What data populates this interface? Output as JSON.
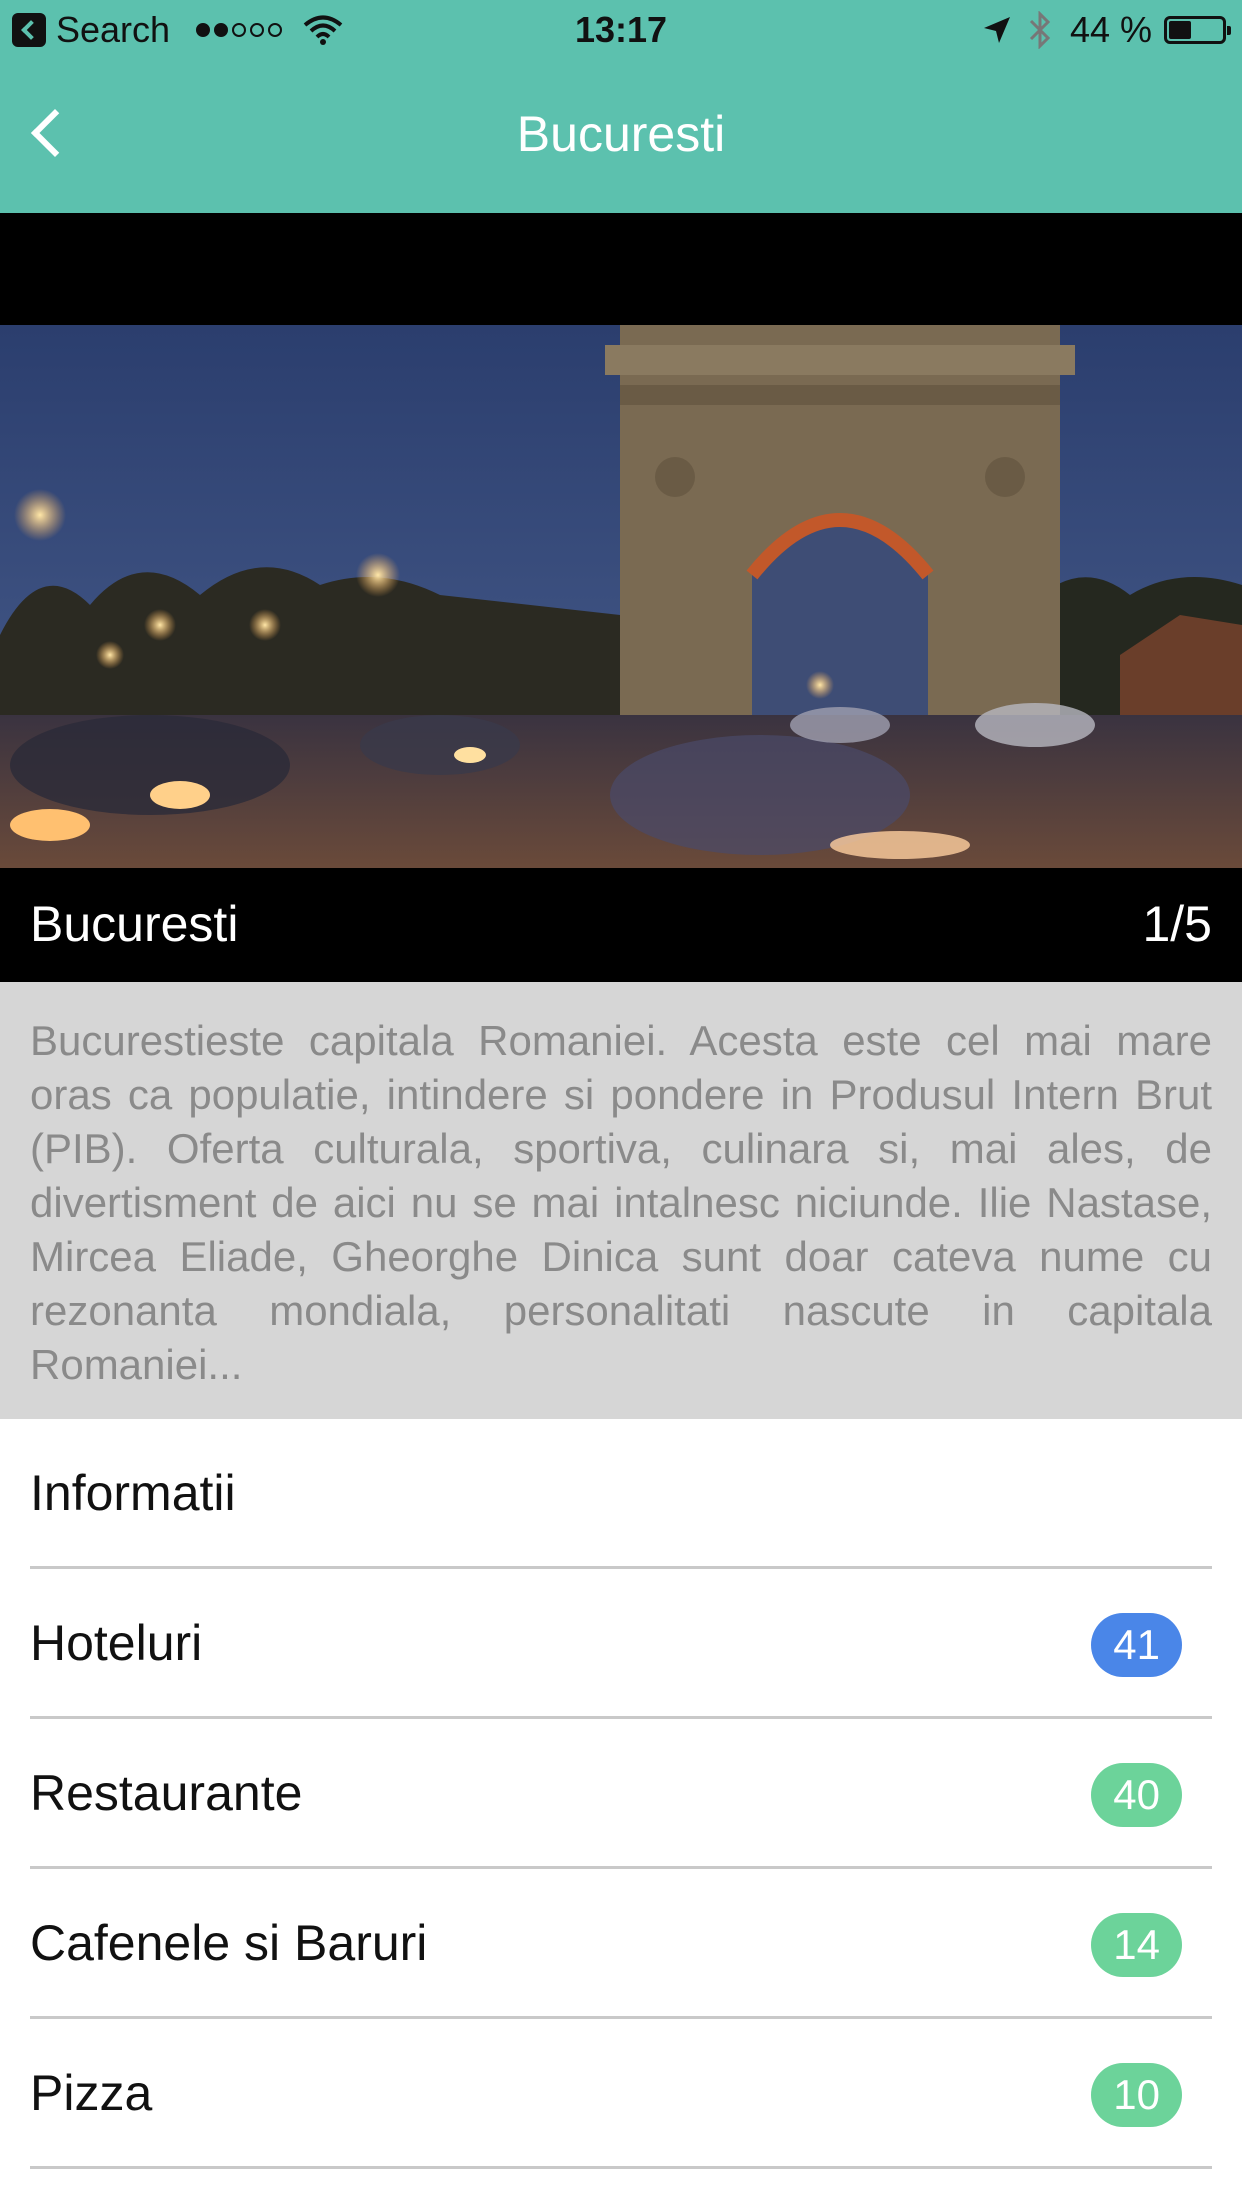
{
  "status_bar": {
    "back_app": "Search",
    "signal_dots": [
      true,
      true,
      false,
      false,
      false
    ],
    "time": "13:17",
    "battery_text": "44 %",
    "battery_level": 0.44
  },
  "nav": {
    "title": "Bucuresti",
    "back_icon": "chevron-left-icon"
  },
  "hero": {
    "caption_title": "Bucuresti",
    "counter": "1/5"
  },
  "description": "Bucurestieste capitala Romaniei. Acesta este cel mai mare oras ca populatie, intindere si pondere in Produsul Intern Brut (PIB). Oferta culturala, sportiva, culinara si, mai ales, de divertisment de aici nu se mai intalnesc niciunde. Ilie Nastase, Mircea Eliade, Gheorghe Dinica sunt doar cateva nume cu rezonanta mondiala, personalitati nascute in capitala Romaniei...",
  "list": [
    {
      "label": "Informatii"
    },
    {
      "label": "Hoteluri",
      "count": "41",
      "badge_color": "#4a86e8"
    },
    {
      "label": "Restaurante",
      "count": "40",
      "badge_color": "#6cd39a"
    },
    {
      "label": "Cafenele si Baruri",
      "count": "14",
      "badge_color": "#6cd39a"
    },
    {
      "label": "Pizza",
      "count": "10",
      "badge_color": "#6cd39a"
    }
  ],
  "colors": {
    "header": "#5cc1ae",
    "description_bg": "#d6d6d6",
    "description_text": "#8a8a8a"
  }
}
